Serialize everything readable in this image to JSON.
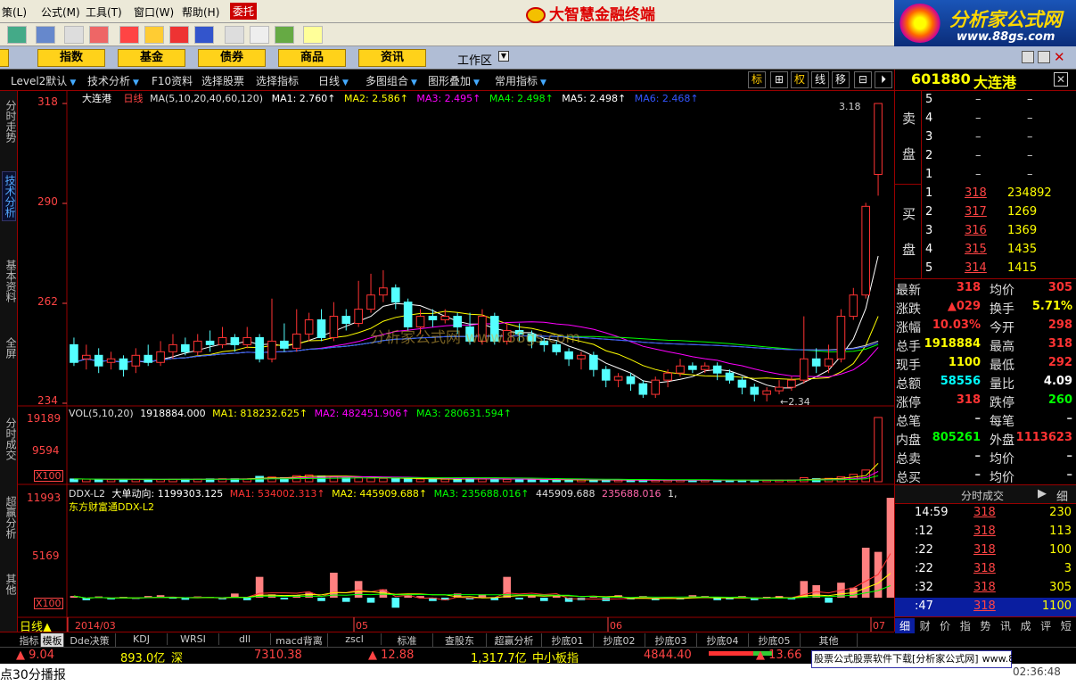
{
  "menu": {
    "items": [
      "策(L)",
      "公式(M)",
      "工具(T)",
      "窗口(W)",
      "帮助(H)"
    ],
    "entrust": "委托",
    "brand": "大智慧金融终端"
  },
  "logo": {
    "title": "分析家公式网",
    "url": "www.88gs.com"
  },
  "tabs": [
    "指数",
    "基金",
    "债券",
    "商品",
    "资讯"
  ],
  "workspace": "工作区",
  "subbar": {
    "level2": "Level2默认",
    "tech": "技术分析",
    "f10": "F10资料",
    "select_stock": "选择股票",
    "select_ind": "选择指标",
    "period": "日线",
    "multi": "多图组合",
    "overlay": "图形叠加",
    "common": "常用指标"
  },
  "rbuttons": [
    "标",
    "⊞",
    "权",
    "线",
    "移",
    "⊟",
    "⏵"
  ],
  "left_tabs": [
    "分时走势",
    "技术分析",
    "基本资料",
    "全屏",
    "分时成交",
    "超赢分析",
    "其他"
  ],
  "main_panel": {
    "name": "大连港",
    "period": "日线",
    "ma_params": "MA(5,10,20,40,60,120)",
    "ma": [
      {
        "label": "MA1:",
        "value": "2.760",
        "color": "#ffffff"
      },
      {
        "label": "MA2:",
        "value": "2.586",
        "color": "#ffff00"
      },
      {
        "label": "MA3:",
        "value": "2.495",
        "color": "#ff00ff"
      },
      {
        "label": "MA4:",
        "value": "2.498",
        "color": "#00ff00"
      },
      {
        "label": "MA5:",
        "value": "2.498",
        "color": "#ffffff"
      },
      {
        "label": "MA6:",
        "value": "2.468",
        "color": "#3355ff"
      }
    ],
    "y_labels": [
      "318",
      "290",
      "262",
      "234"
    ],
    "high_label": "3.18",
    "low_label": "2.34",
    "watermark": "分析家公式网 www.88gs.com"
  },
  "vol_panel": {
    "title": "VOL(5,10,20)",
    "value": "1918884.000",
    "ma": [
      {
        "label": "MA1:",
        "value": "818232.625",
        "color": "#ffff00"
      },
      {
        "label": "MA2:",
        "value": "482451.906",
        "color": "#ff00ff"
      },
      {
        "label": "MA3:",
        "value": "280631.594",
        "color": "#00ff00"
      }
    ],
    "y_labels": [
      "19189",
      "9594"
    ],
    "unit": "X100"
  },
  "ddx_panel": {
    "title": "DDX-L2",
    "sub": "大单动向:",
    "value": "1199303.125",
    "ma": [
      {
        "label": "MA1:",
        "value": "534002.313",
        "color": "#ff3333"
      },
      {
        "label": "MA2:",
        "value": "445909.688",
        "color": "#ffff00"
      },
      {
        "label": "MA3:",
        "value": "235688.016",
        "color": "#00ff00"
      }
    ],
    "extra": [
      "445909.688",
      "235688.016",
      "1,"
    ],
    "subtitle": "东方财富通DDX-L2",
    "y_labels": [
      "11993",
      "5169"
    ],
    "unit": "X100"
  },
  "x_axis": {
    "period_label": "日线",
    "labels": [
      "2014/03",
      "05",
      "06",
      "07"
    ]
  },
  "stock": {
    "code": "601880",
    "name": "大连港"
  },
  "sell": [
    {
      "lvl": "5",
      "p": "–",
      "v": "–"
    },
    {
      "lvl": "4",
      "p": "–",
      "v": "–"
    },
    {
      "lvl": "3",
      "p": "–",
      "v": "–"
    },
    {
      "lvl": "2",
      "p": "–",
      "v": "–"
    },
    {
      "lvl": "1",
      "p": "–",
      "v": "–"
    }
  ],
  "buy": [
    {
      "lvl": "1",
      "p": "318",
      "v": "234892"
    },
    {
      "lvl": "2",
      "p": "317",
      "v": "1269"
    },
    {
      "lvl": "3",
      "p": "316",
      "v": "1369"
    },
    {
      "lvl": "4",
      "p": "315",
      "v": "1435"
    },
    {
      "lvl": "5",
      "p": "314",
      "v": "1415"
    }
  ],
  "sell_label": [
    "卖",
    "盘"
  ],
  "buy_label": [
    "买",
    "盘"
  ],
  "quotes": [
    {
      "l1": "最新",
      "v1": "318",
      "c1": "#ff3333",
      "l2": "均价",
      "v2": "305",
      "c2": "#ff3333"
    },
    {
      "l1": "涨跌",
      "v1": "▲029",
      "c1": "#ff3333",
      "l2": "换手",
      "v2": "5.71%",
      "c2": "#ffff00"
    },
    {
      "l1": "涨幅",
      "v1": "10.03%",
      "c1": "#ff3333",
      "l2": "今开",
      "v2": "298",
      "c2": "#ff3333"
    },
    {
      "l1": "总手",
      "v1": "1918884",
      "c1": "#ffff00",
      "l2": "最高",
      "v2": "318",
      "c2": "#ff3333"
    },
    {
      "l1": "现手",
      "v1": "1100",
      "c1": "#ffff00",
      "l2": "最低",
      "v2": "292",
      "c2": "#ff3333"
    },
    {
      "l1": "总额",
      "v1": "58556",
      "c1": "#00ffff",
      "l2": "量比",
      "v2": "4.09",
      "c2": "#ffffff"
    },
    {
      "l1": "涨停",
      "v1": "318",
      "c1": "#ff3333",
      "l2": "跌停",
      "v2": "260",
      "c2": "#00ff00"
    },
    {
      "l1": "总笔",
      "v1": "–",
      "c1": "#cccccc",
      "l2": "每笔",
      "v2": "–",
      "c2": "#cccccc"
    },
    {
      "l1": "内盘",
      "v1": "805261",
      "c1": "#00ff00",
      "l2": "外盘",
      "v2": "1113623",
      "c2": "#ff3333"
    },
    {
      "l1": "总卖",
      "v1": "–",
      "c1": "#cccccc",
      "l2": "均价",
      "v2": "–",
      "c2": "#cccccc"
    },
    {
      "l1": "总买",
      "v1": "–",
      "c1": "#cccccc",
      "l2": "均价",
      "v2": "–",
      "c2": "#cccccc"
    }
  ],
  "ticks_header": {
    "title": "分时成交",
    "btn": "细"
  },
  "ticks": [
    {
      "t": "14:59",
      "p": "318",
      "v": "230"
    },
    {
      "t": ":12",
      "p": "318",
      "v": "113"
    },
    {
      "t": ":22",
      "p": "318",
      "v": "100"
    },
    {
      "t": ":22",
      "p": "318",
      "v": "3"
    },
    {
      "t": ":32",
      "p": "318",
      "v": "305"
    },
    {
      "t": ":47",
      "p": "318",
      "v": "1100"
    }
  ],
  "right_bottom_tabs": [
    "细",
    "财",
    "价",
    "指",
    "势",
    "讯",
    "成",
    "评",
    "短"
  ],
  "bottom_tabs": [
    "指标",
    "模板",
    "Dde决策",
    "KDJ",
    "WRSI",
    "dll",
    "macd背离",
    "zscl",
    "标准",
    "查股东",
    "超赢分析",
    "抄底01",
    "抄底02",
    "抄底03",
    "抄底04",
    "抄底05",
    "其他"
  ],
  "status1": {
    "a": "▲ 9.04",
    "b": "893.0亿",
    "c": "深",
    "d": "7310.38",
    "e": "▲ 12.88",
    "f": "1,317.7亿",
    "g": "中小板指",
    "h": "4844.40",
    "i": "▲ 13.66"
  },
  "status2": {
    "left": "点30分播报",
    "ad": "股票公式股票软件下载[分析家公式网]",
    "url": "www.88gs.com",
    "time": "02:36:48"
  },
  "chart_data": {
    "type": "candlestick",
    "title": "大连港 日线",
    "x_range": [
      "2014/03",
      "2014/07"
    ],
    "y_range": [
      2.34,
      3.18
    ],
    "candles": [
      [
        2.5,
        2.45,
        2.52,
        2.44
      ],
      [
        2.46,
        2.47,
        2.5,
        2.43
      ],
      [
        2.47,
        2.44,
        2.49,
        2.42
      ],
      [
        2.45,
        2.46,
        2.48,
        2.43
      ],
      [
        2.46,
        2.43,
        2.47,
        2.41
      ],
      [
        2.44,
        2.47,
        2.49,
        2.42
      ],
      [
        2.47,
        2.45,
        2.5,
        2.44
      ],
      [
        2.45,
        2.48,
        2.51,
        2.44
      ],
      [
        2.48,
        2.5,
        2.53,
        2.46
      ],
      [
        2.5,
        2.48,
        2.52,
        2.47
      ],
      [
        2.48,
        2.51,
        2.53,
        2.47
      ],
      [
        2.51,
        2.5,
        2.54,
        2.48
      ],
      [
        2.5,
        2.52,
        2.55,
        2.49
      ],
      [
        2.52,
        2.5,
        2.53,
        2.48
      ],
      [
        2.5,
        2.52,
        2.55,
        2.49
      ],
      [
        2.52,
        2.46,
        2.53,
        2.45
      ],
      [
        2.46,
        2.51,
        2.63,
        2.45
      ],
      [
        2.51,
        2.49,
        2.56,
        2.48
      ],
      [
        2.49,
        2.53,
        2.6,
        2.48
      ],
      [
        2.53,
        2.57,
        2.59,
        2.51
      ],
      [
        2.57,
        2.52,
        2.6,
        2.51
      ],
      [
        2.52,
        2.58,
        2.62,
        2.51
      ],
      [
        2.58,
        2.56,
        2.6,
        2.54
      ],
      [
        2.56,
        2.6,
        2.68,
        2.55
      ],
      [
        2.6,
        2.64,
        2.7,
        2.59
      ],
      [
        2.64,
        2.66,
        2.71,
        2.62
      ],
      [
        2.66,
        2.62,
        2.67,
        2.6
      ],
      [
        2.62,
        2.55,
        2.63,
        2.54
      ],
      [
        2.55,
        2.58,
        2.6,
        2.53
      ],
      [
        2.58,
        2.57,
        2.6,
        2.55
      ],
      [
        2.57,
        2.58,
        2.6,
        2.56
      ],
      [
        2.58,
        2.55,
        2.59,
        2.53
      ],
      [
        2.55,
        2.51,
        2.59,
        2.5
      ],
      [
        2.51,
        2.58,
        2.6,
        2.5
      ],
      [
        2.58,
        2.51,
        2.59,
        2.5
      ],
      [
        2.51,
        2.54,
        2.56,
        2.5
      ],
      [
        2.54,
        2.53,
        2.56,
        2.51
      ],
      [
        2.53,
        2.51,
        2.54,
        2.49
      ],
      [
        2.51,
        2.5,
        2.52,
        2.48
      ],
      [
        2.5,
        2.48,
        2.51,
        2.47
      ],
      [
        2.48,
        2.46,
        2.49,
        2.44
      ],
      [
        2.46,
        2.47,
        2.48,
        2.43
      ],
      [
        2.47,
        2.43,
        2.48,
        2.41
      ],
      [
        2.43,
        2.4,
        2.44,
        2.38
      ],
      [
        2.4,
        2.41,
        2.42,
        2.38
      ],
      [
        2.41,
        2.39,
        2.42,
        2.37
      ],
      [
        2.39,
        2.36,
        2.4,
        2.35
      ],
      [
        2.36,
        2.4,
        2.41,
        2.35
      ],
      [
        2.4,
        2.42,
        2.43,
        2.38
      ],
      [
        2.42,
        2.44,
        2.46,
        2.41
      ],
      [
        2.44,
        2.43,
        2.45,
        2.42
      ],
      [
        2.43,
        2.44,
        2.45,
        2.42
      ],
      [
        2.44,
        2.42,
        2.45,
        2.4
      ],
      [
        2.42,
        2.4,
        2.43,
        2.39
      ],
      [
        2.4,
        2.38,
        2.41,
        2.36
      ],
      [
        2.38,
        2.36,
        2.39,
        2.34
      ],
      [
        2.36,
        2.37,
        2.38,
        2.34
      ],
      [
        2.37,
        2.38,
        2.4,
        2.36
      ],
      [
        2.38,
        2.4,
        2.41,
        2.37
      ],
      [
        2.4,
        2.46,
        2.58,
        2.39
      ],
      [
        2.46,
        2.44,
        2.49,
        2.42
      ],
      [
        2.44,
        2.46,
        2.5,
        2.42
      ],
      [
        2.46,
        2.58,
        2.6,
        2.45
      ],
      [
        2.58,
        2.64,
        2.66,
        2.57
      ],
      [
        2.64,
        2.89,
        2.9,
        2.63
      ],
      [
        2.98,
        3.18,
        3.18,
        2.92
      ]
    ],
    "volume_x100": [
      820,
      760,
      700,
      640,
      680,
      720,
      690,
      650,
      700,
      760,
      800,
      850,
      900,
      870,
      820,
      1600,
      1400,
      1200,
      1800,
      2000,
      1700,
      1500,
      1300,
      1200,
      1100,
      1000,
      900,
      850,
      800,
      780,
      760,
      740,
      1000,
      900,
      800,
      700,
      650,
      600,
      580,
      560,
      540,
      520,
      500,
      480,
      470,
      460,
      450,
      460,
      480,
      500,
      490,
      480,
      470,
      460,
      450,
      440,
      460,
      480,
      500,
      1200,
      900,
      1000,
      1500,
      2200,
      3500,
      19189
    ],
    "ddx_x100": [
      200,
      -300,
      150,
      -200,
      100,
      -150,
      200,
      300,
      -100,
      -250,
      150,
      100,
      -200,
      500,
      -300,
      2500,
      400,
      -200,
      300,
      600,
      -400,
      3000,
      -500,
      2000,
      -600,
      1000,
      -1200,
      300,
      200,
      -400,
      -300,
      500,
      -200,
      400,
      -300,
      2500,
      -200,
      300,
      -400,
      200,
      -500,
      -300,
      200,
      -400,
      300,
      -200,
      200,
      -300,
      100,
      -200,
      300,
      200,
      -300,
      -200,
      200,
      -300,
      100,
      200,
      -200,
      2000,
      1500,
      -600,
      1800,
      1200,
      6000,
      5500,
      11993
    ]
  }
}
